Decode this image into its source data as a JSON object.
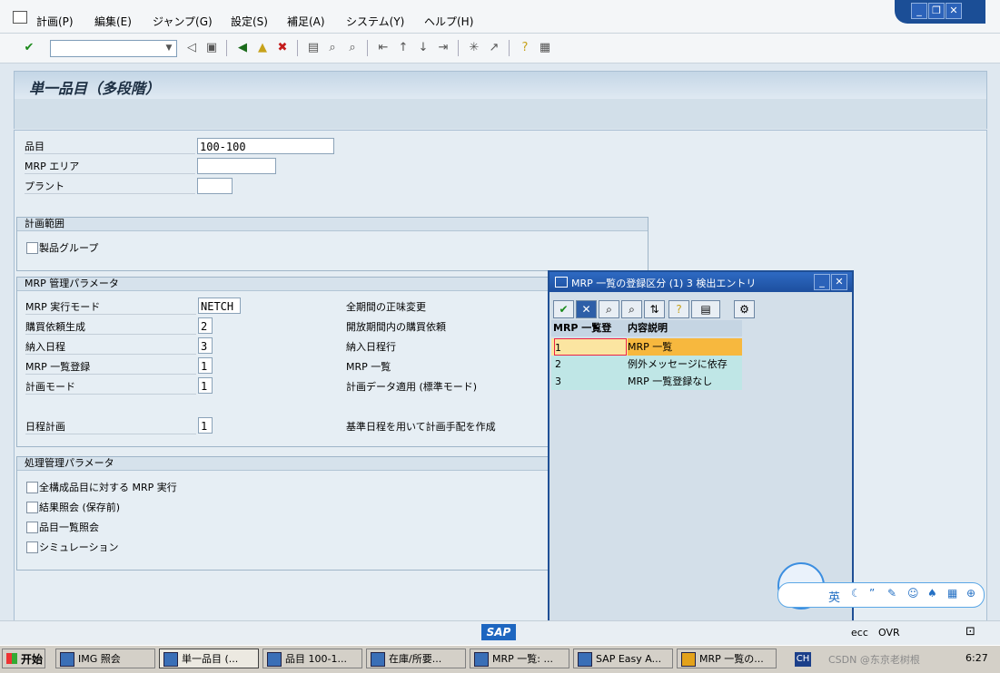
{
  "menu": {
    "items": [
      "計画(P)",
      "編集(E)",
      "ジャンプ(G)",
      "設定(S)",
      "補足(A)",
      "システム(Y)",
      "ヘルプ(H)"
    ]
  },
  "window_controls": {
    "minimize": "_",
    "restore": "❐",
    "close": "✕"
  },
  "screen": {
    "title": "単一品目（多段階）",
    "fields": {
      "material_label": "品目",
      "material_value": "100-100",
      "mrp_area_label": "MRP エリア",
      "mrp_area_value": "",
      "plant_label": "プラント",
      "plant_value": ""
    },
    "scope": {
      "title": "計画範囲",
      "product_group_label": "製品グループ"
    },
    "mrp_params": {
      "title": "MRP 管理パラメータ",
      "rows": [
        {
          "label": "MRP 実行モード",
          "value": "NETCH",
          "desc": "全期間の正味変更"
        },
        {
          "label": "購買依頼生成",
          "value": "2",
          "desc": "開放期間内の購買依頼"
        },
        {
          "label": "納入日程",
          "value": "3",
          "desc": "納入日程行"
        },
        {
          "label": "MRP 一覧登録",
          "value": "1",
          "desc": "MRP 一覧"
        },
        {
          "label": "計画モード",
          "value": "1",
          "desc": "計画データ適用 (標準モード)"
        },
        {
          "label": "日程計画",
          "value": "1",
          "desc": "基準日程を用いて計画手配を作成"
        }
      ]
    },
    "process_params": {
      "title": "処理管理パラメータ",
      "checks": [
        "全構成品目に対する MRP 実行",
        "結果照会 (保存前)",
        "品目一覧照会",
        "シミュレーション"
      ]
    }
  },
  "popup": {
    "title": "MRP 一覧の登録区分 (1)   3 検出エントリ",
    "col_key": "MRP 一覧登",
    "col_desc": "内容説明",
    "rows": [
      {
        "key": "1",
        "desc": "MRP 一覧"
      },
      {
        "key": "2",
        "desc": "例外メッセージに依存"
      },
      {
        "key": "3",
        "desc": "MRP 一覧登録なし"
      }
    ]
  },
  "status": {
    "system": "ecc",
    "mode": "OVR",
    "logo": "SAP"
  },
  "taskbar": {
    "start": "开始",
    "tasks": [
      "IMG 照会",
      "単一品目 (...",
      "品目 100-1...",
      "在庫/所要...",
      "MRP 一覧: ...",
      "SAP Easy A...",
      "MRP 一覧の..."
    ],
    "lang": "CH",
    "time": "6:27",
    "watermark": "CSDN @东京老树根"
  },
  "ime": {
    "mode": "英"
  }
}
